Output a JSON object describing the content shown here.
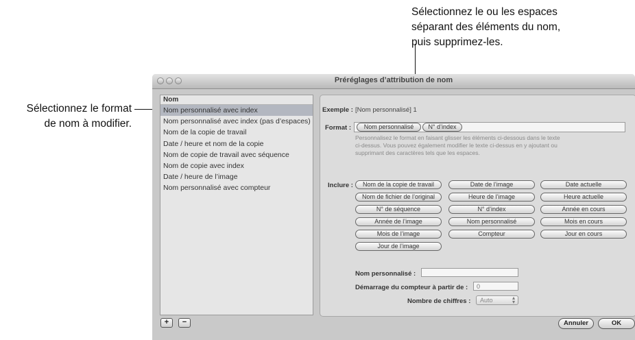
{
  "callouts": {
    "left_line1": "Sélectionnez le format",
    "left_line2": "de nom à modifier.",
    "top_line1": "Sélectionnez le ou les espaces",
    "top_line2": "séparant des éléments du nom,",
    "top_line3": "puis supprimez-les."
  },
  "window": {
    "title": "Préréglages d’attribution de nom"
  },
  "list": {
    "header": "Nom",
    "items": [
      "Nom personnalisé avec index",
      "Nom personnalisé avec index (pas d’espaces)",
      "Nom de la copie de travail",
      "Date / heure et nom de la copie",
      "Nom de copie de travail avec séquence",
      "Nom de copie avec index",
      "Date / heure de l’image",
      "Nom personnalisé avec compteur"
    ],
    "selected_index": 0
  },
  "panel": {
    "exemple_label": "Exemple :",
    "exemple_value": "[Nom personnalisé] 1",
    "format_label": "Format :",
    "format_tokens": [
      "Nom personnalisé",
      "N° d’index"
    ],
    "hint_line1": "Personnalisez le format en faisant glisser les éléments ci-dessous dans le texte",
    "hint_line2": "ci-dessus. Vous pouvez également modifier le texte ci-dessus en y ajoutant ou",
    "hint_line3": "supprimant des caractères tels que les espaces.",
    "inclure_label": "Inclure :",
    "include_buttons": [
      "Nom de la copie de travail",
      "Date de l’image",
      "Date actuelle",
      "Nom de fichier de l’original",
      "Heure de l’image",
      "Heure actuelle",
      "N° de séquence",
      "N° d’index",
      "Année en cours",
      "Année de l’image",
      "Nom personnalisé",
      "Mois en cours",
      "Mois de l’image",
      "Compteur",
      "Jour en cours",
      "Jour de l’image"
    ],
    "custom_name_label": "Nom personnalisé :",
    "custom_name_value": "",
    "counter_start_label": "Démarrage du compteur à partir de :",
    "counter_start_value": "0",
    "digits_label": "Nombre de chiffres :",
    "digits_value": "Auto"
  },
  "footer": {
    "add_label": "+",
    "remove_label": "−",
    "cancel_label": "Annuler",
    "ok_label": "OK"
  }
}
